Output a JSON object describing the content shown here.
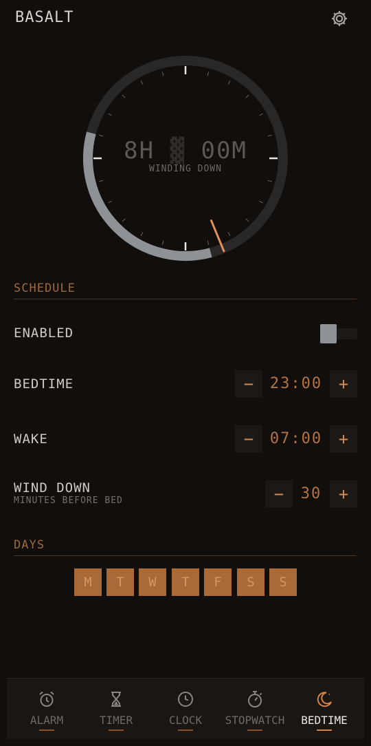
{
  "app": {
    "title": "BASALT"
  },
  "dial": {
    "duration_hours": "8H",
    "duration_minutes": "00M",
    "status": "WINDING DOWN",
    "track_color": "#2a2826",
    "arc_color": "#8e9296",
    "hand_color": "#e0905a"
  },
  "schedule": {
    "title": "SCHEDULE",
    "enabled_label": "ENABLED",
    "bedtime_label": "BEDTIME",
    "bedtime_value": "23:00",
    "wake_label": "WAKE",
    "wake_value": "07:00",
    "wind_down_label": "WIND DOWN",
    "wind_down_sub": "MINUTES BEFORE BED",
    "wind_down_value": "30",
    "minus": "−",
    "plus": "+"
  },
  "days": {
    "title": "DAYS",
    "items": [
      "M",
      "T",
      "W",
      "T",
      "F",
      "S",
      "S"
    ]
  },
  "nav": {
    "items": [
      {
        "label": "ALARM",
        "icon": "alarm-clock-icon"
      },
      {
        "label": "TIMER",
        "icon": "hourglass-icon"
      },
      {
        "label": "CLOCK",
        "icon": "clock-icon"
      },
      {
        "label": "STOPWATCH",
        "icon": "stopwatch-icon"
      },
      {
        "label": "BEDTIME",
        "icon": "moon-icon",
        "active": true
      }
    ]
  },
  "colors": {
    "accent": "#d58242",
    "background": "#120e0c"
  }
}
